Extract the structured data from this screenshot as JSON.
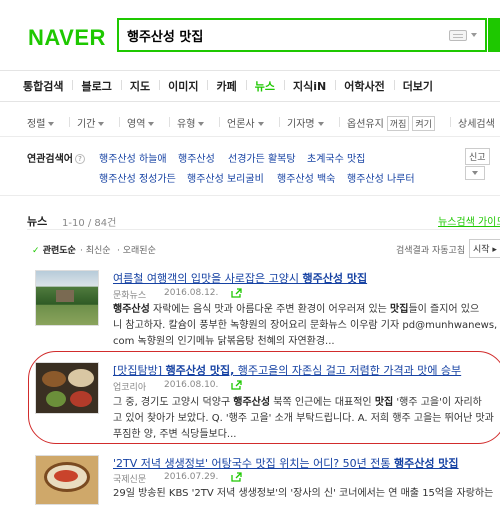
{
  "logo": "NAVER",
  "search": {
    "query": "행주산성 맛집"
  },
  "tabs": [
    "통합검색",
    "블로그",
    "지도",
    "이미지",
    "카페",
    "뉴스",
    "지식iN",
    "어학사전",
    "더보기"
  ],
  "filters": {
    "sort": "정렬",
    "period": "기간",
    "area": "영역",
    "type": "유형",
    "press": "언론사",
    "reporter": "기자명",
    "option_label": "옵션유지",
    "option_state": "꺼짐",
    "option_toggle": "켜기",
    "detail": "상세검색"
  },
  "related": {
    "label": "연관검색어",
    "help": "?",
    "row1": [
      "행주산성 하늘애",
      "행주산성",
      "선경가든 활복탕",
      "초계국수 맛집"
    ],
    "row2": [
      "행주산성 정성가든",
      "행주산성 보리굴비",
      "행주산성 백숙",
      "행주산성 나루터"
    ],
    "report": "신고"
  },
  "news": {
    "title": "뉴스",
    "count": "1-10 / 84건",
    "guide": "뉴스검색 가이드",
    "sort_options": [
      "관련도순",
      "최신순",
      "오래된순"
    ],
    "sort_hint": "검색결과 자동고침",
    "sort_button": "시작"
  },
  "articles": [
    {
      "title_pre": "여름철 여행객의 입맛을 사로잡은 고양시 ",
      "title_kw": "행주산성 맛집",
      "source": "문화뉴스",
      "date": "2016.08.12.",
      "line1_kw": "행주산성",
      "line1_a": " 자락에는 음식 맛과 아름다운 주변 환경이 어우러져 있는 ",
      "line1_kw2": "맛집",
      "line1_b": "들이 즐지어 있으",
      "line2": "니 참고하자. 칼슘이 풍부한 녹향원의 장어요리 문화뉴스 이우람 기자 pd@munhwanews,",
      "line3": "com 녹향원의 인기메뉴 닭볶음탕 천혜의 자연환경..."
    },
    {
      "title_pre": "[맛집탐방] ",
      "title_kw": "행주산성 맛집,",
      "title_post": " 행주고을의 자존심 걸고 저렴한 가격과 맛에 승부",
      "source": "업코리아",
      "date": "2016.08.10.",
      "line1_a": "그 중, 경기도 고양시 덕양구 ",
      "line1_kw": "행주산성",
      "line1_b": " 북쪽 인근에는 대표적인 ",
      "line1_kw2": "맛집",
      "line1_c": " '행주 고을'이 자리하",
      "line2": "고 있어 찾아가 보았다. Q. '행주 고을' 소개 부탁드립니다. A. 저희 행주 고을는 뛰어난 맛과",
      "line3": "푸짐한 양, 주변 식당들보다..."
    },
    {
      "title_pre": "'2TV 저녁 생생정보' 어탕국수 맛집 위치는 어디? 50년 전통 ",
      "title_kw": "행주산성 맛집",
      "source": "국제신문",
      "date": "2016.07.29.",
      "line1": "29일 방송된 KBS '2TV 저녁 생생정보'의 '장사의 신' 코너에서는 연 매출 15억을 자랑하는"
    }
  ]
}
